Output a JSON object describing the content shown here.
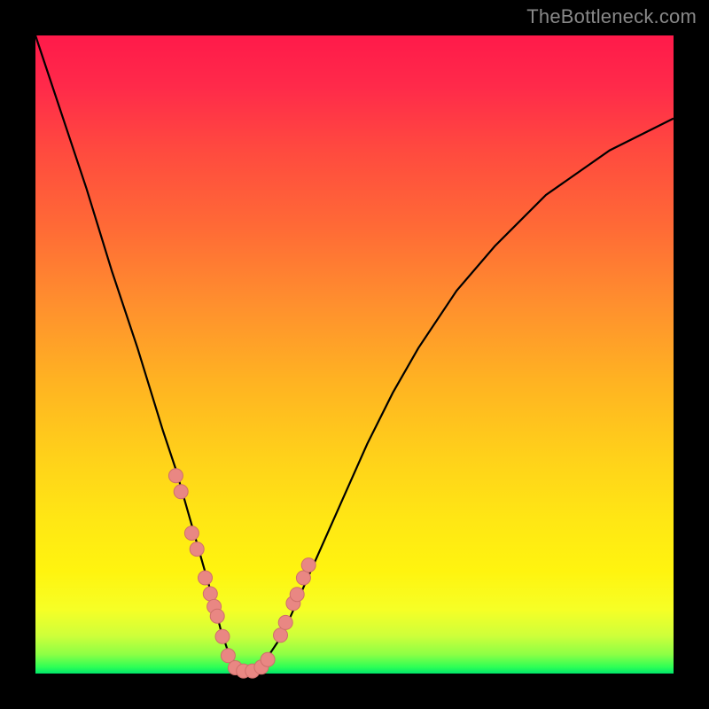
{
  "watermark": "TheBottleneck.com",
  "colors": {
    "frame": "#000000",
    "curve": "#000000",
    "marker_fill": "#e98783",
    "marker_stroke": "#cf6f6b"
  },
  "chart_data": {
    "type": "line",
    "title": "",
    "xlabel": "",
    "ylabel": "",
    "xlim": [
      0,
      100
    ],
    "ylim": [
      0,
      100
    ],
    "grid": false,
    "series": [
      {
        "name": "curve",
        "x": [
          0,
          4,
          8,
          12,
          16,
          20,
          22,
          24,
          26,
          28,
          29,
          30,
          31,
          32,
          33,
          34,
          35,
          36,
          38,
          40,
          44,
          48,
          52,
          56,
          60,
          66,
          72,
          80,
          90,
          100
        ],
        "values": [
          100,
          88,
          76,
          63,
          51,
          38,
          32,
          25,
          18,
          11,
          7,
          4,
          2,
          1,
          0.5,
          0.5,
          1,
          2,
          5,
          9,
          18,
          27,
          36,
          44,
          51,
          60,
          67,
          75,
          82,
          87
        ]
      }
    ],
    "markers": {
      "comment": "salmon dots overlaid on the two curve branches near the bottom",
      "x": [
        22.0,
        22.8,
        24.5,
        25.3,
        26.6,
        27.4,
        28.0,
        28.5,
        29.3,
        30.2,
        31.3,
        32.6,
        34.0,
        35.4,
        36.4,
        38.4,
        39.2,
        40.4,
        41.0,
        42.0,
        42.8
      ],
      "y": [
        31.0,
        28.5,
        22.0,
        19.5,
        15.0,
        12.5,
        10.5,
        9.0,
        5.8,
        2.8,
        0.9,
        0.4,
        0.4,
        1.0,
        2.2,
        6.0,
        8.0,
        11.0,
        12.4,
        15.0,
        17.0
      ]
    }
  }
}
